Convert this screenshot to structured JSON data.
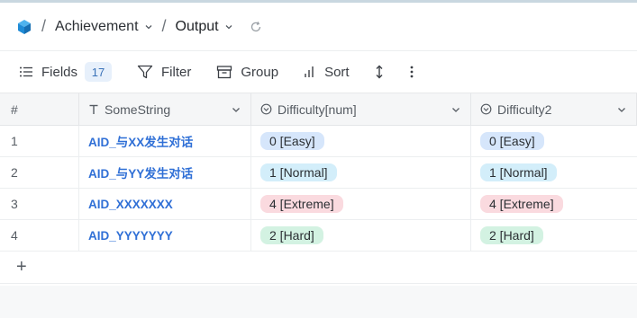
{
  "breadcrumb": {
    "separator": "/",
    "items": [
      {
        "label": "Achievement"
      },
      {
        "label": "Output"
      }
    ]
  },
  "toolbar": {
    "fields_label": "Fields",
    "fields_count": "17",
    "filter_label": "Filter",
    "group_label": "Group",
    "sort_label": "Sort"
  },
  "table": {
    "columns": {
      "index": "#",
      "name": "SomeString",
      "d1": "Difficulty[num]",
      "d2": "Difficulty2"
    },
    "rows": [
      {
        "index": "1",
        "name": "AID_与XX发生对话",
        "d1": "0 [Easy]",
        "d2": "0 [Easy]",
        "color": "#d6e6fb"
      },
      {
        "index": "2",
        "name": "AID_与YY发生对话",
        "d1": "1 [Normal]",
        "d2": "1 [Normal]",
        "color": "#d3eefa"
      },
      {
        "index": "3",
        "name": "AID_XXXXXXX",
        "d1": "4 [Extreme]",
        "d2": "4 [Extreme]",
        "color": "#fadadf"
      },
      {
        "index": "4",
        "name": "AID_YYYYYYY",
        "d1": "2 [Hard]",
        "d2": "2 [Hard]",
        "color": "#d3f2e2"
      }
    ],
    "add_row_glyph": "+"
  },
  "colors": {
    "link": "#2f6fd6",
    "badge_bg": "#e7f0fb",
    "logo": "#1f8bd6"
  }
}
